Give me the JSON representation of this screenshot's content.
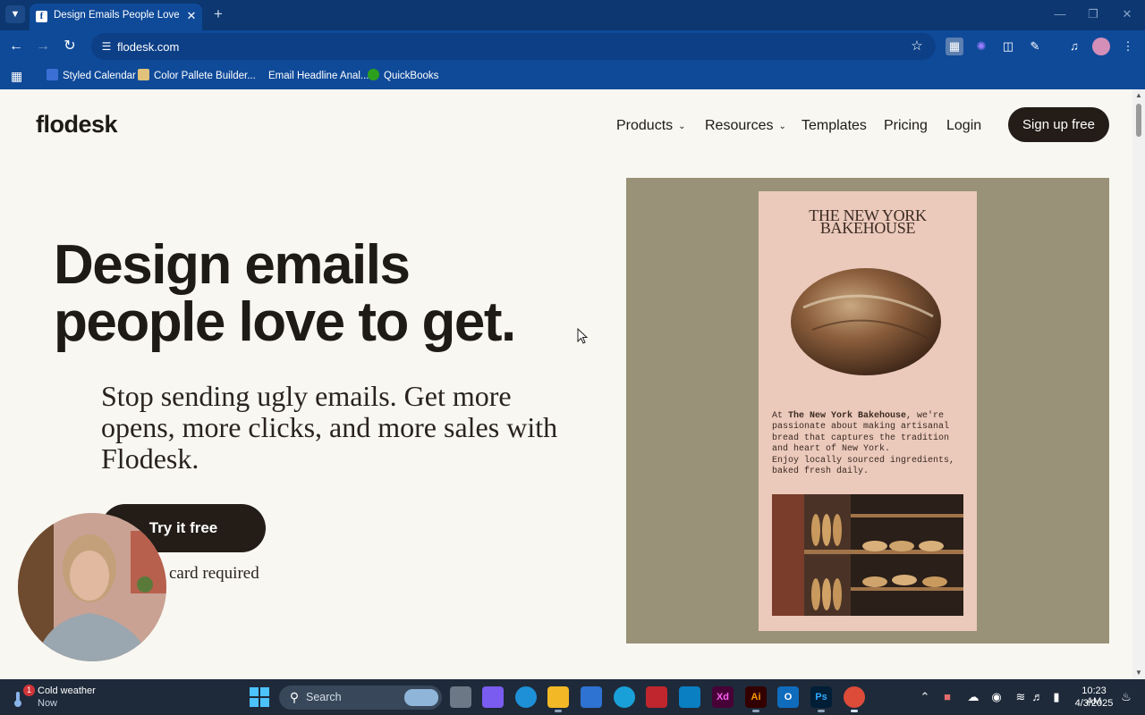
{
  "browser": {
    "tab_title": "Design Emails People Love to G",
    "tab_favicon": "f",
    "url": "flodesk.com",
    "bookmarks": [
      "Styled Calendar",
      "Color Pallete Builder...",
      "Email Headline Anal...",
      "QuickBooks"
    ]
  },
  "site": {
    "logo": "flodesk",
    "nav": {
      "products": "Products",
      "resources": "Resources",
      "templates": "Templates",
      "pricing": "Pricing",
      "login": "Login",
      "signup": "Sign up free"
    },
    "hero": {
      "title_line1": "Design emails",
      "title_line2": "people love to get.",
      "subtitle": "Stop sending ugly emails. Get more opens, more clicks, and more sales with Flodesk.",
      "cta": "Try it free",
      "note": "No credit card required"
    },
    "email_preview": {
      "brand_line1": "THE NEW YORK",
      "brand_line2": "BAKEHOUSE",
      "copy_prefix": "At ",
      "copy_brand": "The New York Bakehouse",
      "copy_rest": ", we're passionate about making artisanal bread that captures the tradition and heart of New York.",
      "copy_line2": "Enjoy locally sourced ingredients, baked fresh daily."
    }
  },
  "taskbar": {
    "weather_title": "Cold weather",
    "weather_sub": "Now",
    "weather_badge": "1",
    "search_placeholder": "Search",
    "time": "10:23 AM",
    "date": "4/3/2025"
  },
  "colors": {
    "chrome": "#0f4a99",
    "page_bg": "#f8f7f1",
    "primary_dark": "#231c17",
    "showcase_bg": "#999178",
    "email_card": "#ebc9bb"
  }
}
